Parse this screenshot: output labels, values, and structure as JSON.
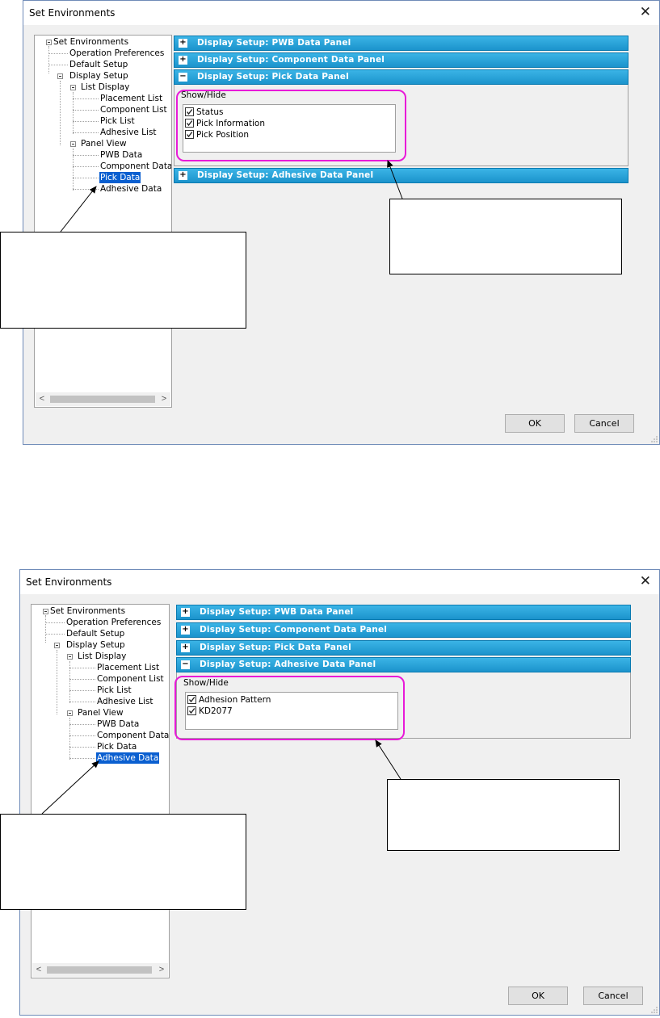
{
  "dialog1": {
    "title": "Set Environments",
    "tree": {
      "root": "Set Environments",
      "operation_preferences": "Operation Preferences",
      "default_setup": "Default Setup",
      "display_setup": "Display Setup",
      "list_display": "List Display",
      "placement_list": "Placement List",
      "component_list": "Component List",
      "pick_list": "Pick List",
      "adhesive_list": "Adhesive List",
      "panel_view": "Panel View",
      "pwb_data": "PWB Data",
      "component_data": "Component Data",
      "pick_data": "Pick Data",
      "adhesive_data": "Adhesive Data",
      "selected": "Pick Data"
    },
    "panels": [
      {
        "label": "Display Setup: PWB Data Panel",
        "state": "+"
      },
      {
        "label": "Display Setup: Component Data Panel",
        "state": "+"
      },
      {
        "label": "Display Setup: Pick Data Panel",
        "state": "−"
      },
      {
        "label": "Display Setup: Adhesive Data Panel",
        "state": "+"
      }
    ],
    "show_hide_label": "Show/Hide",
    "checkboxes": [
      {
        "label": "Status",
        "checked": true
      },
      {
        "label": "Pick Information",
        "checked": true
      },
      {
        "label": "Pick Position",
        "checked": true
      }
    ],
    "ok_label": "OK",
    "cancel_label": "Cancel"
  },
  "dialog2": {
    "title": "Set Environments",
    "tree": {
      "root": "Set Environments",
      "operation_preferences": "Operation Preferences",
      "default_setup": "Default Setup",
      "display_setup": "Display Setup",
      "list_display": "List Display",
      "placement_list": "Placement List",
      "component_list": "Component List",
      "pick_list": "Pick List",
      "adhesive_list": "Adhesive List",
      "panel_view": "Panel View",
      "pwb_data": "PWB Data",
      "component_data": "Component Data",
      "pick_data": "Pick Data",
      "adhesive_data": "Adhesive Data",
      "selected": "Adhesive Data"
    },
    "panels": [
      {
        "label": "Display Setup: PWB Data Panel",
        "state": "+"
      },
      {
        "label": "Display Setup: Component Data Panel",
        "state": "+"
      },
      {
        "label": "Display Setup: Pick Data Panel",
        "state": "+"
      },
      {
        "label": "Display Setup: Adhesive Data Panel",
        "state": "−"
      }
    ],
    "show_hide_label": "Show/Hide",
    "checkboxes": [
      {
        "label": "Adhesion Pattern",
        "checked": true
      },
      {
        "label": "KD2077",
        "checked": true
      }
    ],
    "ok_label": "OK",
    "cancel_label": "Cancel"
  },
  "colors": {
    "panel_header": "#1ea0d8",
    "selection": "#0a5fd0",
    "highlight": "#e81ad8"
  }
}
